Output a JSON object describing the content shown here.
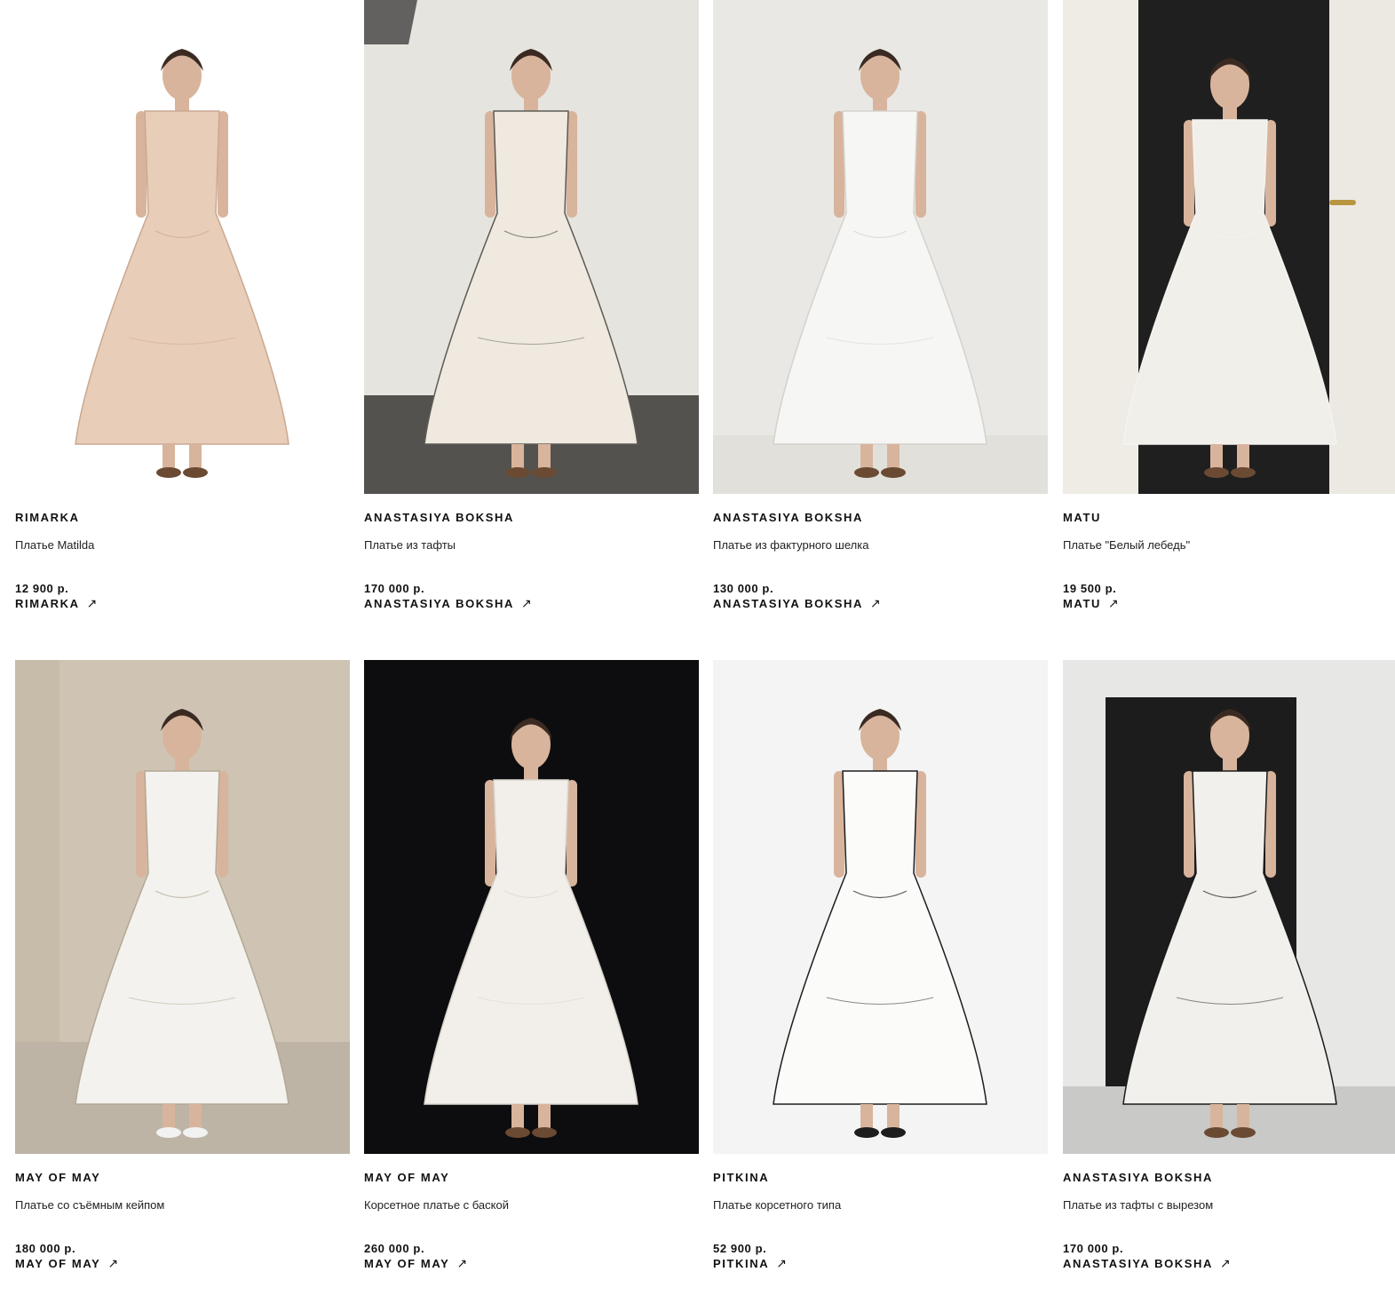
{
  "products": [
    {
      "brand": "RIMARKA",
      "title": "Платье Matilda",
      "price": "12 900 р.",
      "link_label": "RIMARKA",
      "link_icon": "arrow-up-right-icon",
      "photo": {
        "background": "#ffffff",
        "dress_color": "#e8cdb9",
        "accent": "#c9a892"
      }
    },
    {
      "brand": "ANASTASIYA BOKSHA",
      "title": "Платье из тафты",
      "price": "170 000 р.",
      "link_label": "ANASTASIYA BOKSHA",
      "link_icon": "arrow-up-right-icon",
      "photo": {
        "background": "#e6e4df",
        "dress_color": "#efe9e0",
        "accent": "#5d5a55"
      }
    },
    {
      "brand": "ANASTASIYA BOKSHA",
      "title": "Платье из фактурного шелка",
      "price": "130 000 р.",
      "link_label": "ANASTASIYA BOKSHA",
      "link_icon": "arrow-up-right-icon",
      "photo": {
        "background": "#e9e8e5",
        "dress_color": "#f6f6f4",
        "accent": "#d4d2cc"
      }
    },
    {
      "brand": "MATU",
      "title": "Платье \"Белый лебедь\"",
      "price": "19 500 р.",
      "link_label": "MATU",
      "link_icon": "arrow-up-right-icon",
      "photo": {
        "background": "#1f1f1f",
        "dress_color": "#f1efea",
        "accent": "#f5f3ef"
      }
    },
    {
      "brand": "MAY OF MAY",
      "title": "Платье со съёмным кейпом",
      "price": "180 000 р.",
      "link_label": "MAY OF MAY",
      "link_icon": "arrow-up-right-icon",
      "photo": {
        "background": "#cfc4b3",
        "dress_color": "#f3f2ee",
        "accent": "#b3a893"
      }
    },
    {
      "brand": "MAY OF MAY",
      "title": "Корсетное платье с баской",
      "price": "260 000 р.",
      "link_label": "MAY OF MAY",
      "link_icon": "arrow-up-right-icon",
      "photo": {
        "background": "#0d0d0f",
        "dress_color": "#f2efea",
        "accent": "#d8d4cd"
      }
    },
    {
      "brand": "PITKINA",
      "title": "Платье корсетного типа",
      "price": "52 900 р.",
      "link_label": "PITKINA",
      "link_icon": "arrow-up-right-icon",
      "photo": {
        "background": "#f4f4f4",
        "dress_color": "#fbfbfa",
        "accent": "#1d1d1d"
      }
    },
    {
      "brand": "ANASTASIYA BOKSHA",
      "title": "Платье из тафты с вырезом",
      "price": "170 000 р.",
      "link_label": "ANASTASIYA BOKSHA",
      "link_icon": "arrow-up-right-icon",
      "photo": {
        "background": "#e7e7e5",
        "dress_color": "#f2f0ec",
        "accent": "#1a1a1a"
      }
    }
  ]
}
